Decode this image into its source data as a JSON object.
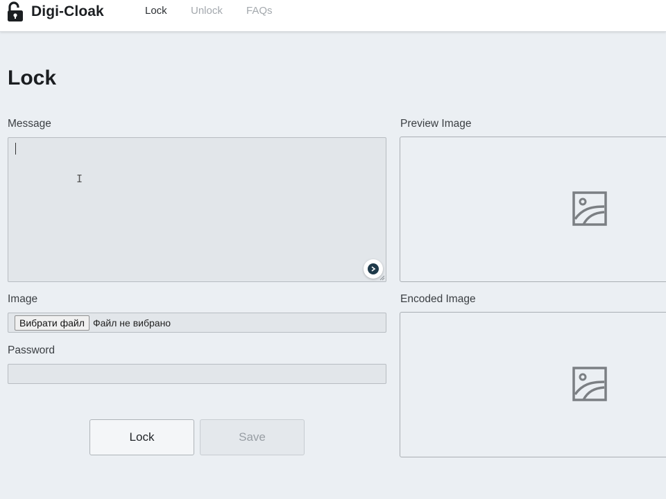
{
  "nav": {
    "brand": "Digi-Cloak",
    "brand_icon": "unlocked-padlock-icon",
    "links": [
      {
        "label": "Lock",
        "active": true
      },
      {
        "label": "Unlock",
        "active": false
      },
      {
        "label": "FAQs",
        "active": false
      }
    ]
  },
  "page": {
    "title": "Lock"
  },
  "form": {
    "message_label": "Message",
    "message_value": "",
    "image_label": "Image",
    "file_button_label": "Вибрати файл",
    "file_status": "Файл не вибрано",
    "password_label": "Password",
    "password_value": "",
    "lock_button": "Lock",
    "save_button": "Save"
  },
  "previews": {
    "preview_label": "Preview Image",
    "encoded_label": "Encoded Image",
    "placeholder_icon": "image-placeholder-icon"
  },
  "colors": {
    "background": "#ebeff3",
    "navbar": "#ffffff",
    "input_bg": "#e2e6ea",
    "active_nav": "#2b2f33",
    "inactive_nav": "#a3a8ad"
  }
}
